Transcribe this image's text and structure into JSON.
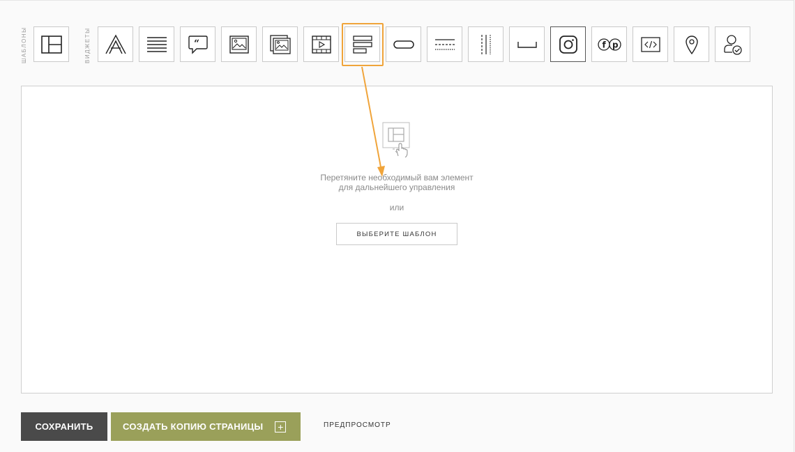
{
  "labels": {
    "templates": "ШАБЛОНЫ",
    "widgets": "ВИДЖЕТЫ"
  },
  "toolbar": {
    "templates": [
      {
        "icon": "layout-template-icon"
      }
    ],
    "widgets": [
      {
        "icon": "heading-text-icon"
      },
      {
        "icon": "paragraph-text-icon"
      },
      {
        "icon": "quote-icon"
      },
      {
        "icon": "image-icon"
      },
      {
        "icon": "gallery-icon"
      },
      {
        "icon": "video-icon"
      },
      {
        "icon": "menu-blocks-icon",
        "highlighted": true
      },
      {
        "icon": "button-icon"
      },
      {
        "icon": "horizontal-divider-icon"
      },
      {
        "icon": "vertical-divider-icon"
      },
      {
        "icon": "spacer-icon"
      },
      {
        "icon": "instagram-icon",
        "selected": true
      },
      {
        "icon": "social-facebook-pinterest-icon"
      },
      {
        "icon": "embed-code-icon"
      },
      {
        "icon": "map-pin-icon"
      },
      {
        "icon": "user-verified-icon"
      }
    ]
  },
  "canvas": {
    "hint_line1": "Перетяните необходимый вам элемент",
    "hint_line2": "для дальнейшего управления",
    "or": "или",
    "choose_template": "ВЫБЕРИТЕ ШАБЛОН"
  },
  "footer": {
    "save": "СОХРАНИТЬ",
    "copy_page": "СОЗДАТЬ КОПИЮ СТРАНИЦЫ",
    "copy_plus": "+",
    "preview": "ПРЕДПРОСМОТР"
  },
  "colors": {
    "highlight": "#f0a43a",
    "save_bg": "#4a4a4a",
    "copy_bg": "#9aa05a"
  }
}
